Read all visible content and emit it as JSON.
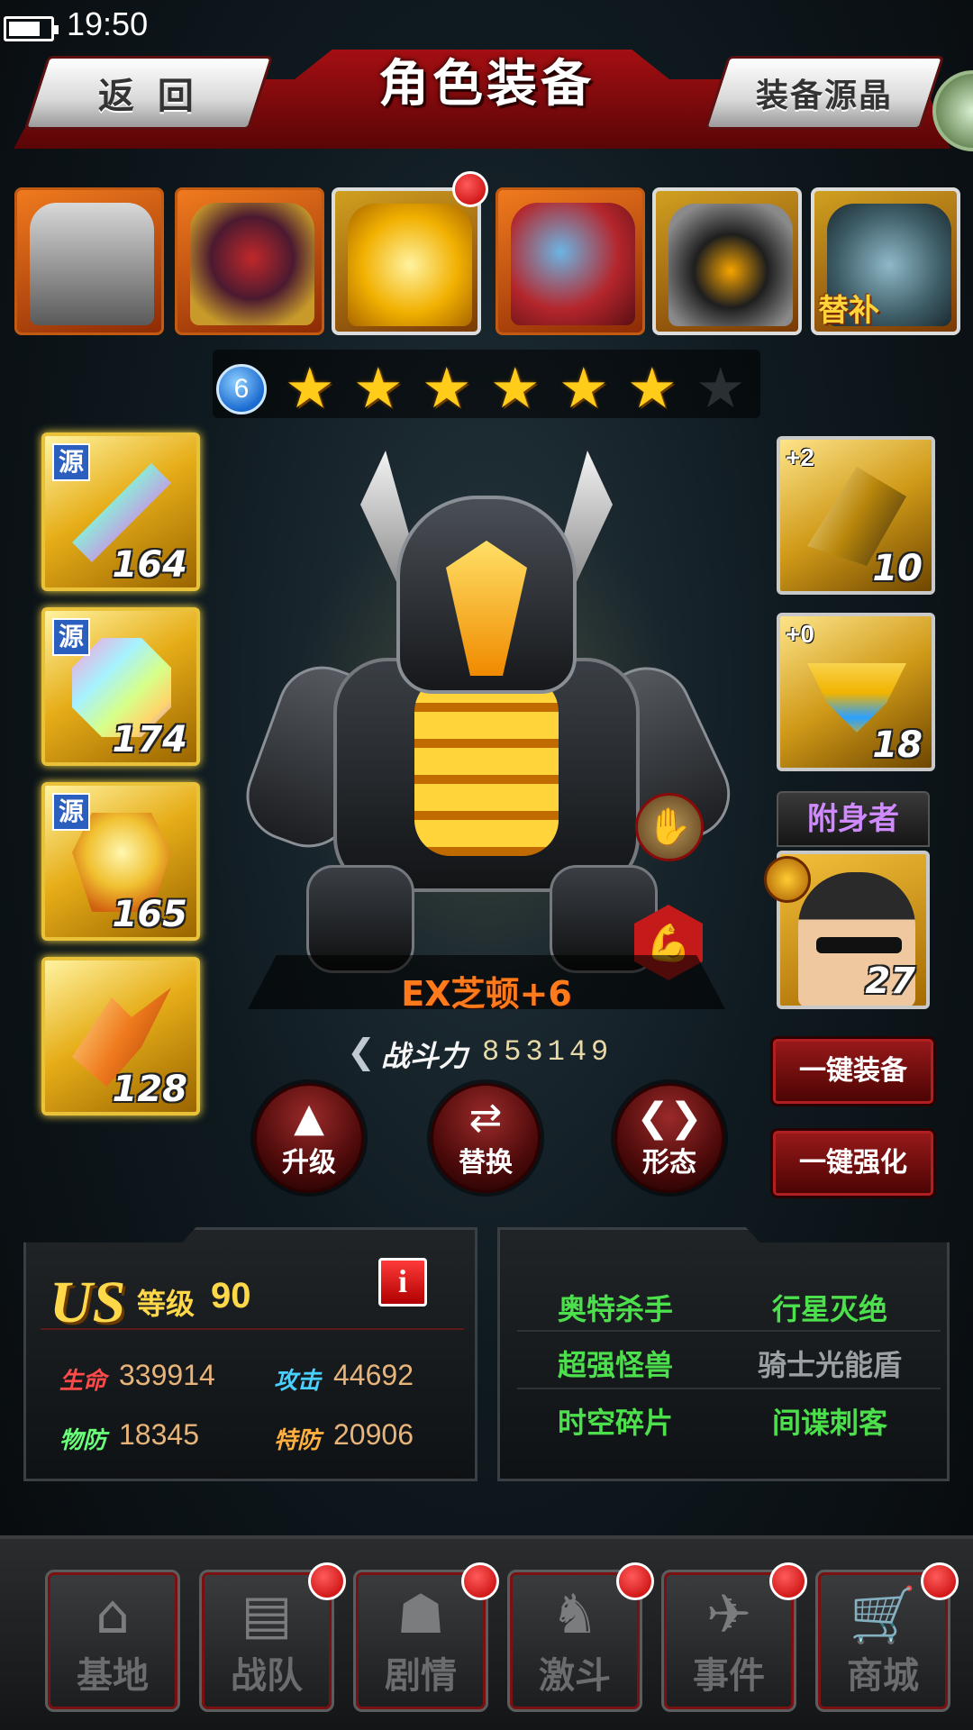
{
  "status_bar": {
    "time": "19:50",
    "battery_level": 0.7
  },
  "header": {
    "back_label": "返 回",
    "title": "角色装备",
    "crystal_label": "装备源晶"
  },
  "roster": {
    "cards": [
      {
        "name": "monster-1",
        "selected": false
      },
      {
        "name": "monster-2",
        "selected": false
      },
      {
        "name": "monster-3",
        "selected": false,
        "badge": true
      },
      {
        "name": "monster-4",
        "selected": false
      },
      {
        "name": "monster-5",
        "selected": true
      },
      {
        "name": "monster-6",
        "selected": false,
        "substitute_label": "替补"
      }
    ]
  },
  "stars": {
    "rank": "6",
    "filled": 6,
    "total": 7
  },
  "left_equipment": [
    {
      "source_label": "源",
      "level": "164",
      "icon": "rainbow-sword-icon"
    },
    {
      "source_label": "源",
      "level": "174",
      "icon": "rainbow-gem-icon"
    },
    {
      "source_label": "源",
      "level": "165",
      "icon": "golden-armor-icon"
    },
    {
      "level": "128",
      "icon": "orange-claw-icon"
    }
  ],
  "right_equipment": [
    {
      "plus": "+2",
      "level": "10",
      "icon": "gold-shard-icon"
    },
    {
      "plus": "+0",
      "level": "18",
      "icon": "gold-collar-icon"
    }
  ],
  "possessor": {
    "label": "附身者",
    "level": "27"
  },
  "monster": {
    "name": "EX芝顿+6"
  },
  "power": {
    "label": "战斗力",
    "value": "853149"
  },
  "actions": {
    "upgrade": "升级",
    "swap": "替换",
    "form": "形态",
    "equip_all": "一键装备",
    "enhance_all": "一键强化"
  },
  "stats": {
    "rank": "US",
    "level_label": "等级",
    "level": "90",
    "info_label": "i",
    "hp_label": "生命",
    "hp": "339914",
    "atk_label": "攻击",
    "atk": "44692",
    "pdef_label": "物防",
    "pdef": "18345",
    "sdef_label": "特防",
    "sdef": "20906"
  },
  "skills": [
    {
      "label": "奥特杀手",
      "active": true
    },
    {
      "label": "行星灭绝",
      "active": true
    },
    {
      "label": "超强怪兽",
      "active": true
    },
    {
      "label": "骑士光能盾",
      "active": false
    },
    {
      "label": "时空碎片",
      "active": true
    },
    {
      "label": "间谍刺客",
      "active": true
    }
  ],
  "nav": [
    {
      "label": "基地",
      "icon": "base-icon",
      "badge": false
    },
    {
      "label": "战队",
      "icon": "team-icon",
      "badge": true
    },
    {
      "label": "剧情",
      "icon": "story-icon",
      "badge": true
    },
    {
      "label": "激斗",
      "icon": "battle-icon",
      "badge": true
    },
    {
      "label": "事件",
      "icon": "event-icon",
      "badge": true
    },
    {
      "label": "商城",
      "icon": "shop-cart-icon",
      "badge": true
    }
  ],
  "colors": {
    "header_red": "#a40f12",
    "gold": "#ffd84a",
    "skill_active": "#4ce04c",
    "skill_inactive": "#9aa0a4",
    "monster_name": "#ff7a1a"
  }
}
